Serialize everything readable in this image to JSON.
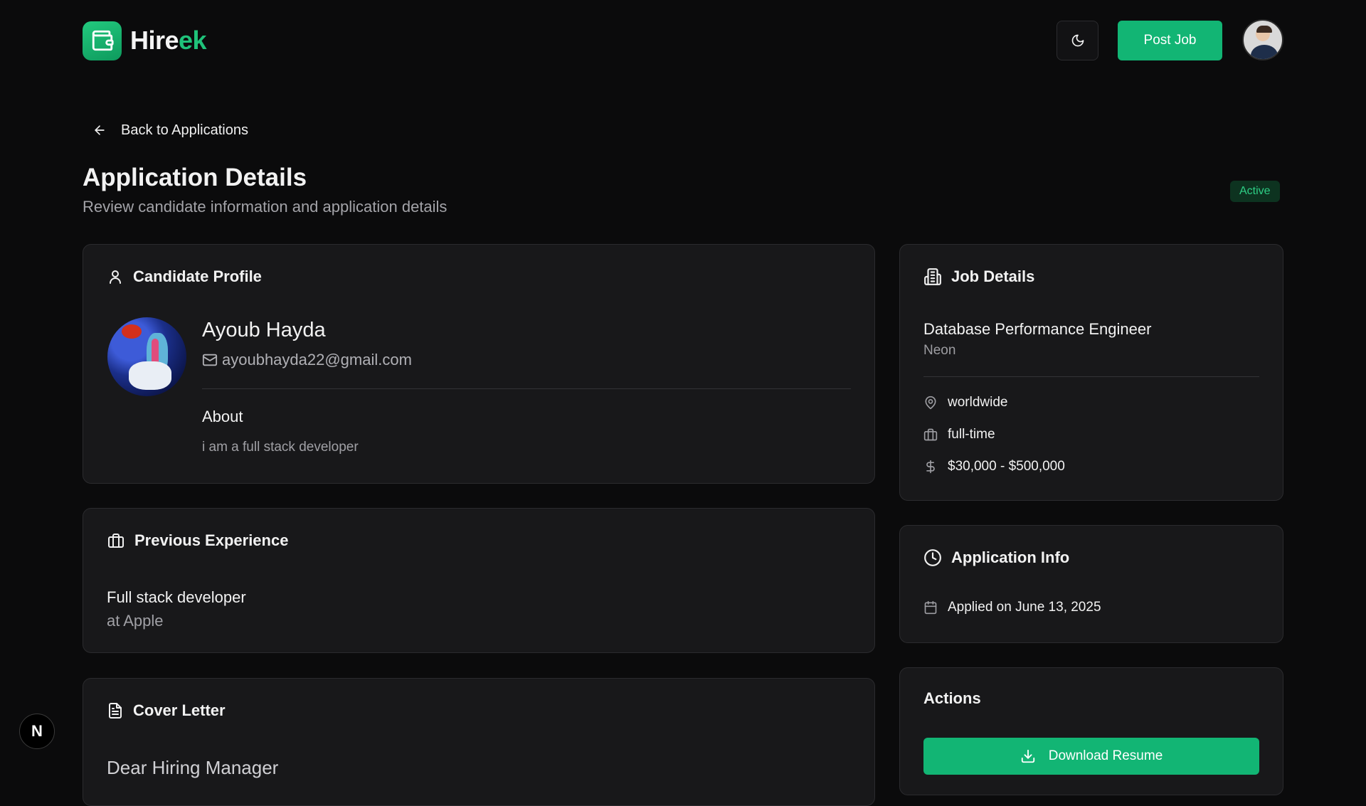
{
  "brand": {
    "name_part1": "Hire",
    "name_part2": "ek"
  },
  "header": {
    "post_job_label": "Post Job"
  },
  "back_link": {
    "label": "Back to Applications"
  },
  "page": {
    "title": "Application Details",
    "subtitle": "Review candidate information and application details",
    "status": "Active"
  },
  "candidate": {
    "heading": "Candidate Profile",
    "name": "Ayoub Hayda",
    "email": "ayoubhayda22@gmail.com",
    "about_label": "About",
    "about_text": "i am a full stack developer"
  },
  "experience": {
    "heading": "Previous Experience",
    "title": "Full stack developer",
    "company": "at Apple"
  },
  "cover_letter": {
    "heading": "Cover Letter",
    "text": "Dear Hiring Manager"
  },
  "job": {
    "heading": "Job Details",
    "title": "Database Performance Engineer",
    "company": "Neon",
    "location": "worldwide",
    "type": "full-time",
    "salary": "$30,000 - $500,000"
  },
  "application_info": {
    "heading": "Application Info",
    "applied": "Applied on June 13, 2025"
  },
  "actions": {
    "heading": "Actions",
    "download_label": "Download Resume"
  },
  "dev_badge": {
    "label": "N"
  },
  "colors": {
    "accent": "#12b574",
    "background": "#0b0b0c",
    "card": "#18181a"
  }
}
